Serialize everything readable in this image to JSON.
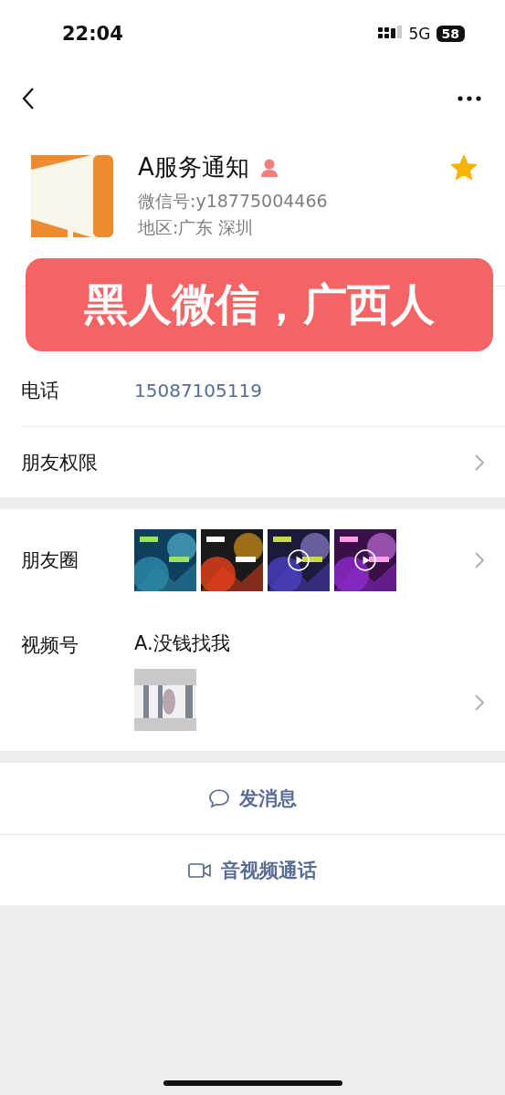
{
  "status_bar": {
    "time": "22:04",
    "network": "5G",
    "battery": "58"
  },
  "profile": {
    "name": "A服务通知",
    "wechat_id": "微信号:y18775004466",
    "region": "地区:广东 深圳",
    "starred": true
  },
  "banner": "黑人微信，广西人",
  "info_rows": [
    {
      "label": "电话",
      "value": "15087105119",
      "chevron": false
    },
    {
      "label": "朋友权限",
      "chevron": true
    }
  ],
  "moments": {
    "label": "朋友圈",
    "photos": [
      {
        "kind": "picture",
        "video": false
      },
      {
        "kind": "picture",
        "video": false
      },
      {
        "kind": "picture",
        "video": true
      },
      {
        "kind": "picture",
        "video": true
      }
    ]
  },
  "channels": {
    "label": "视频号",
    "name": "A.没钱找我",
    "photos": [
      {
        "kind": "picture",
        "video": false
      }
    ]
  },
  "actions": [
    {
      "kind": "message",
      "label": "发消息"
    },
    {
      "kind": "call",
      "label": "音视频通话"
    }
  ]
}
